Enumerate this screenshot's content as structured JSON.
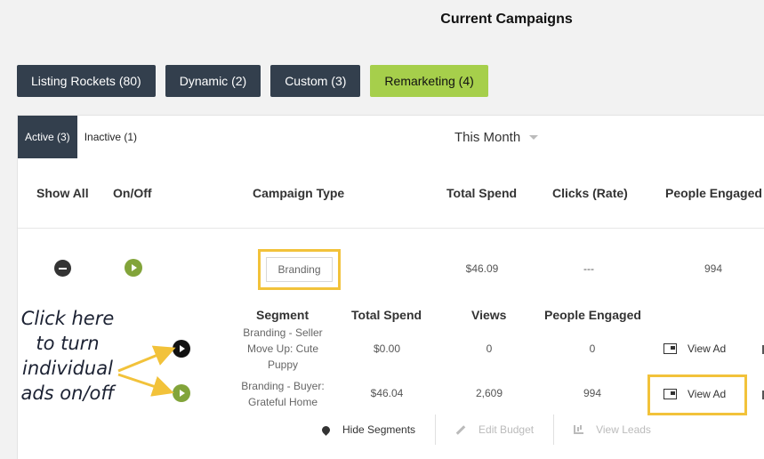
{
  "page": {
    "title": "Current Campaigns"
  },
  "campaign_tabs": [
    {
      "label": "Listing Rockets (80)",
      "active": false
    },
    {
      "label": "Dynamic (2)",
      "active": false
    },
    {
      "label": "Custom (3)",
      "active": false
    },
    {
      "label": "Remarketing (4)",
      "active": true
    }
  ],
  "status_tabs": [
    {
      "label": "Active (3)",
      "active": true
    },
    {
      "label": "Inactive (1)",
      "active": false
    }
  ],
  "period": {
    "selected": "This Month"
  },
  "table_headers": {
    "show_all": "Show All",
    "on_off": "On/Off",
    "campaign_type": "Campaign Type",
    "total_spend": "Total Spend",
    "clicks_rate": "Clicks (Rate)",
    "people_engaged": "People Engaged"
  },
  "campaign_row": {
    "type": "Branding",
    "total_spend": "$46.09",
    "clicks_rate": "---",
    "people_engaged": "994"
  },
  "segment_headers": {
    "segment": "Segment",
    "total_spend": "Total Spend",
    "views": "Views",
    "people_engaged": "People Engaged"
  },
  "segments": [
    {
      "name_lines": [
        "Branding - Seller",
        "Move Up: Cute",
        "Puppy"
      ],
      "total_spend": "$0.00",
      "views": "0",
      "people_engaged": "0",
      "view_ad_label": "View Ad",
      "status": "off"
    },
    {
      "name_lines": [
        "Branding - Buyer:",
        "Grateful Home"
      ],
      "total_spend": "$46.04",
      "views": "2,609",
      "people_engaged": "994",
      "view_ad_label": "View Ad",
      "status": "on"
    }
  ],
  "actions": {
    "hide_segments": "Hide Segments",
    "edit_budget": "Edit Budget",
    "view_leads": "View Leads"
  },
  "annotation": {
    "lines": [
      "Click here",
      "to turn",
      "individual",
      "ads on/off"
    ]
  },
  "colors": {
    "dark_navy": "#333f4d",
    "accent_green": "#a6cf4b",
    "play_green": "#82a43a",
    "highlight_yellow": "#f2c23a",
    "annotation_text": "#1c2233"
  }
}
